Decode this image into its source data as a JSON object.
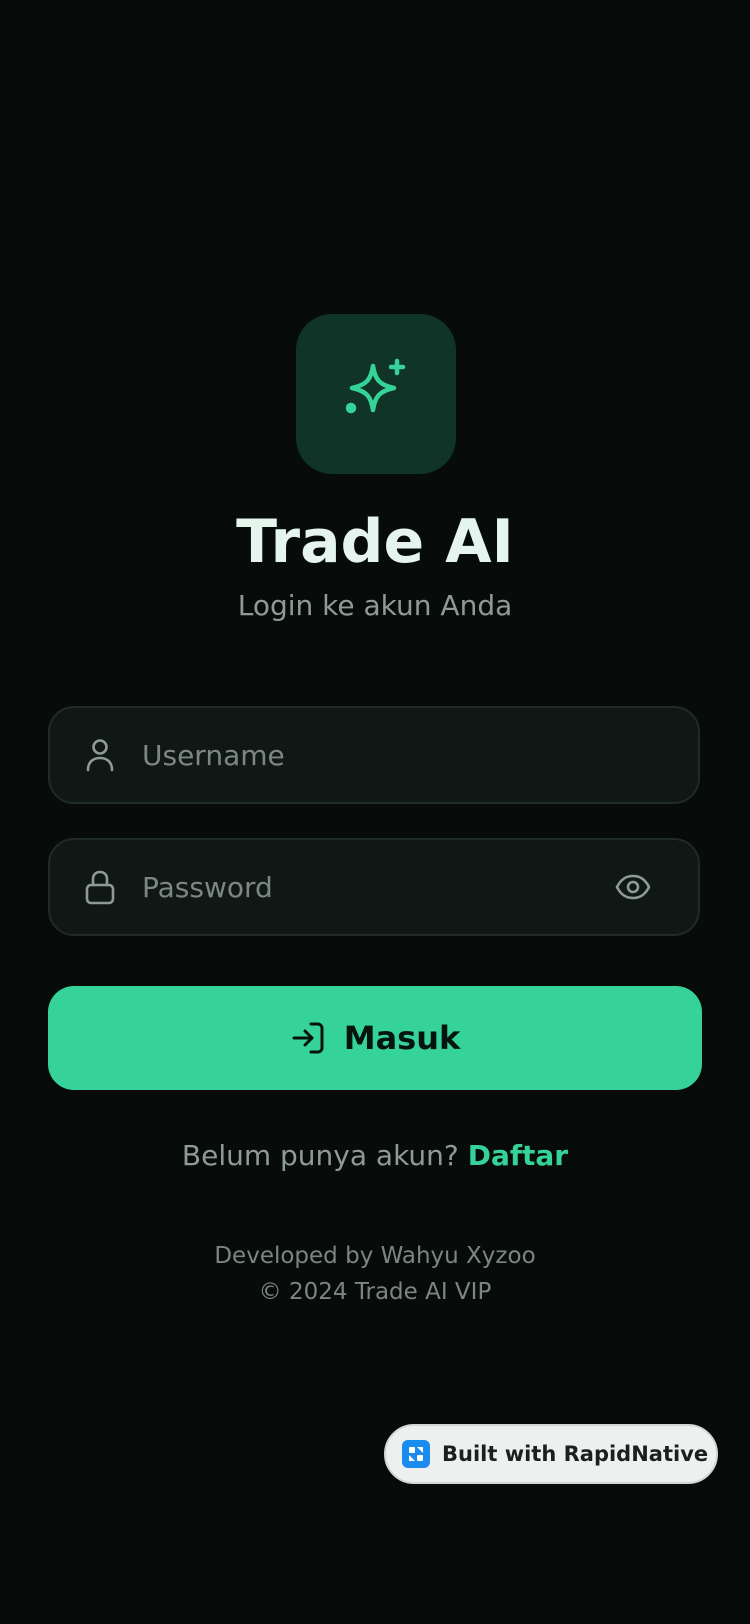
{
  "app": {
    "title": "Trade AI",
    "subtitle": "Login ke akun Anda",
    "logo_icon": "sparkles-icon"
  },
  "form": {
    "username": {
      "value": "",
      "placeholder": "Username",
      "icon": "user-icon"
    },
    "password": {
      "value": "",
      "placeholder": "Password",
      "icon": "lock-icon",
      "toggle_icon": "eye-icon"
    },
    "submit": {
      "label": "Masuk",
      "icon": "login-icon"
    }
  },
  "signup": {
    "prompt": "Belum punya akun?",
    "link": "Daftar"
  },
  "footer": {
    "developer": "Developed by Wahyu Xyzoo",
    "copyright": "© 2024 Trade AI VIP"
  },
  "badge": {
    "label": "Built with RapidNative"
  },
  "colors": {
    "background": "#070c0b",
    "accent": "#35d399",
    "logo_tile": "#103428",
    "field_bg": "#101815",
    "field_border": "#202a27",
    "title_text": "#e6f4ee",
    "muted_text": "#8e9a96"
  }
}
